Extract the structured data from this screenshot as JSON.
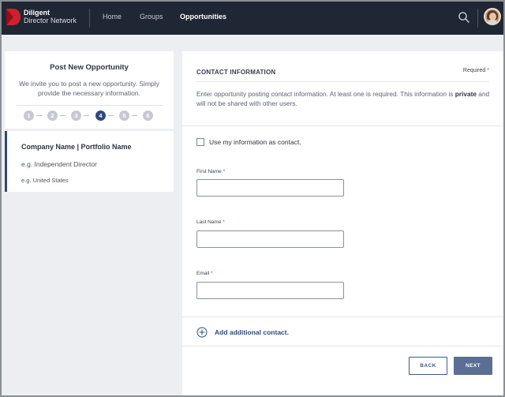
{
  "nav": {
    "brand_line1": "Diligent",
    "brand_line2": "Director Network",
    "links": [
      "Home",
      "Groups",
      "Opportunities"
    ],
    "active_link": "Opportunities",
    "icons": {
      "search": "search-icon",
      "avatar": "user-avatar",
      "logo": "diligent-logo"
    }
  },
  "left": {
    "title": "Post New Opportunity",
    "description": "We invite you to post a new opportunity. Simply provide the necessary information.",
    "steps": [
      "1",
      "2",
      "3",
      "4",
      "5",
      "6"
    ],
    "current_step": "4",
    "summary": {
      "company": "Company Name | Portfolio Name",
      "role": "e.g. Independent Director",
      "country": "e.g. United States"
    }
  },
  "contact": {
    "heading": "CONTACT INFORMATION",
    "required_note": "Required",
    "desc_part1": "Enter opportunity posting contact information. At least one is required. This information is",
    "desc_bold": "private",
    "desc_part2": "and will not be shared with other users.",
    "use_my_info_label": "Use my information as contact.",
    "use_my_info_checked": false,
    "fields": {
      "first_name": {
        "label": "First Name",
        "value": ""
      },
      "last_name": {
        "label": "Last Name",
        "value": ""
      },
      "email": {
        "label": "Email",
        "value": ""
      }
    },
    "add_contact_label": "Add additional contact."
  },
  "actions": {
    "back": "BACK",
    "next": "NEXT"
  },
  "colors": {
    "nav_bg": "#1f2735",
    "accent": "#2e4a7a",
    "next_button": "#5a6f93",
    "required_star": "#c0392b",
    "logo_red": "#d0202e"
  }
}
